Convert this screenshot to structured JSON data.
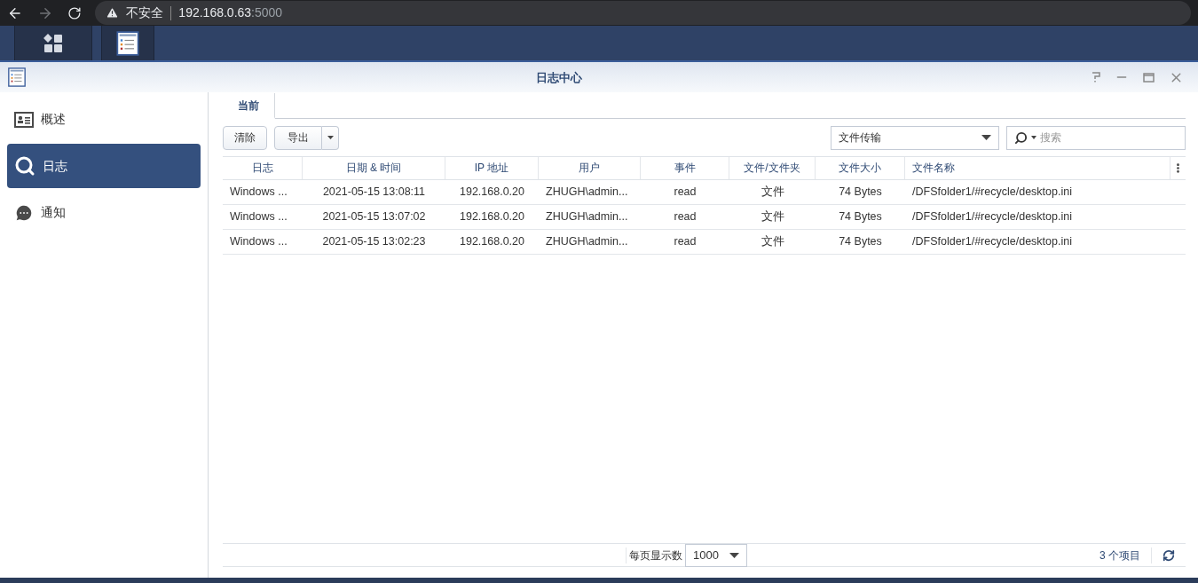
{
  "browser": {
    "forward_disabled": true,
    "security_label": "不安全",
    "host": "192.168.0.63",
    "port": ":5000"
  },
  "window": {
    "title": "日志中心"
  },
  "sidebar": {
    "items": [
      {
        "label": "概述",
        "selected": false
      },
      {
        "label": "日志",
        "selected": true
      },
      {
        "label": "通知",
        "selected": false
      }
    ]
  },
  "tabs": [
    {
      "label": "当前",
      "selected": true
    }
  ],
  "toolbar": {
    "clear": "清除",
    "export": "导出",
    "filter": "文件传输",
    "search": {
      "placeholder": "搜索"
    }
  },
  "table": {
    "columns": [
      "日志",
      "日期 & 时间",
      "IP 地址",
      "用户",
      "事件",
      "文件/文件夹",
      "文件大小",
      "文件名称"
    ],
    "rows": [
      [
        "Windows ...",
        "2021-05-15 13:08:11",
        "192.168.0.20",
        "ZHUGH\\admin...",
        "read",
        "文件",
        "74 Bytes",
        "/DFSfolder1/#recycle/desktop.ini"
      ],
      [
        "Windows ...",
        "2021-05-15 13:07:02",
        "192.168.0.20",
        "ZHUGH\\admin...",
        "read",
        "文件",
        "74 Bytes",
        "/DFSfolder1/#recycle/desktop.ini"
      ],
      [
        "Windows ...",
        "2021-05-15 13:02:23",
        "192.168.0.20",
        "ZHUGH\\admin...",
        "read",
        "文件",
        "74 Bytes",
        "/DFSfolder1/#recycle/desktop.ini"
      ]
    ]
  },
  "footer": {
    "page_size_label": "每页显示数",
    "page_size": "1000",
    "count": "3 个项目"
  }
}
